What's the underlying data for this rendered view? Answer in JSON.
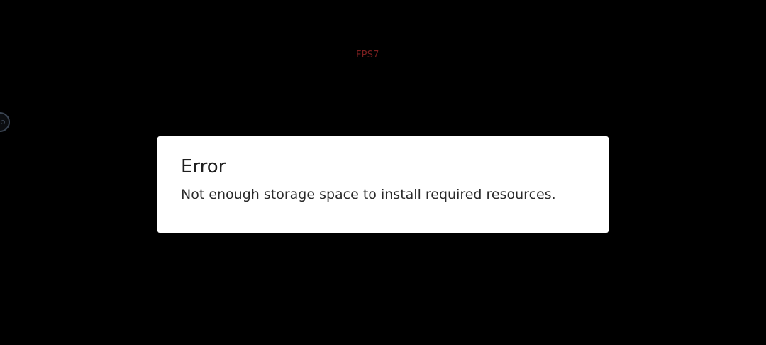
{
  "overlay": {
    "fps_label": "FPS7"
  },
  "floating_button": {
    "icon": "assistive-touch-icon"
  },
  "dialog": {
    "title": "Error",
    "message": "Not enough storage space to install required resources."
  },
  "colors": {
    "background": "#000000",
    "dialog_background": "#ffffff",
    "fps_text": "#7a1f1f",
    "title_text": "#1f1f1f"
  }
}
